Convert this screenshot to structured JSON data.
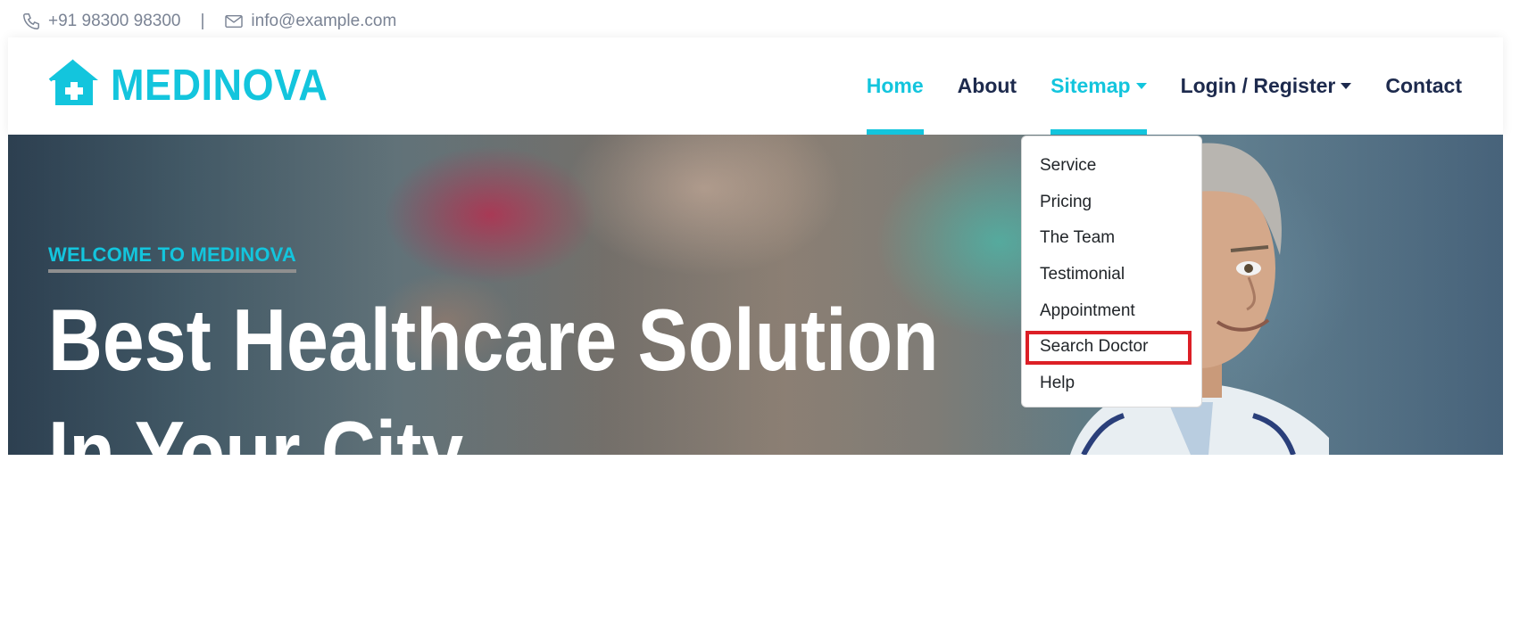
{
  "topbar": {
    "phone_icon": "phone-icon",
    "phone": "+91 98300 98300",
    "separator": "|",
    "email_icon": "envelope-icon",
    "email": "info@example.com"
  },
  "brand": {
    "icon": "house-medical-icon",
    "name": "MEDINOVA"
  },
  "nav": {
    "home": "Home",
    "about": "About",
    "sitemap": "Sitemap",
    "login": "Login / Register",
    "contact": "Contact"
  },
  "dropdown": {
    "items": [
      "Service",
      "Pricing",
      "The Team",
      "Testimonial",
      "Appointment",
      "Search Doctor",
      "Help"
    ],
    "highlighted": "Search Doctor"
  },
  "hero": {
    "eyebrow": "Welcome To Medinova",
    "headline_line1": "Best Healthcare Solution",
    "headline_line2": "In Your City"
  },
  "colors": {
    "accent": "#13c5dd",
    "nav_text": "#1d2a4d",
    "highlight_border": "#dc1f26"
  }
}
